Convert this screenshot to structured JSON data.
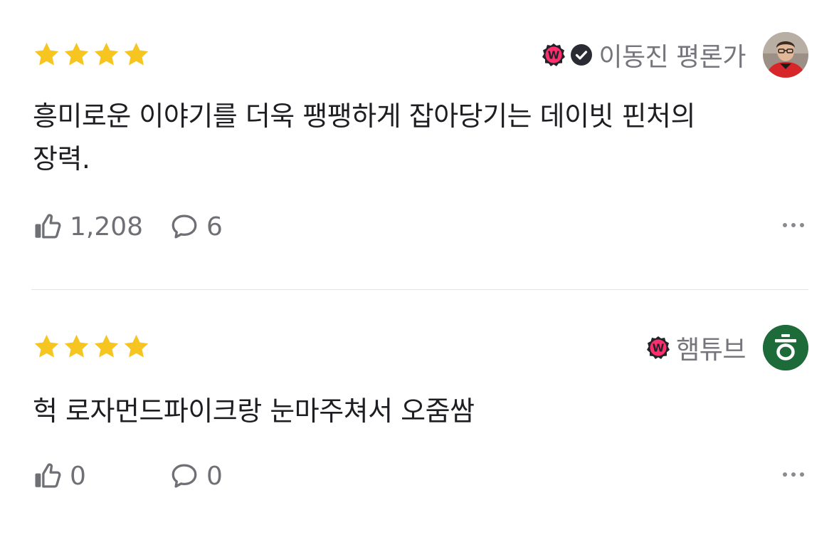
{
  "reviews": [
    {
      "rating": 4,
      "author": {
        "name": "이동진 평론가",
        "badge_w": "W",
        "verified_icon": "check-circle-icon",
        "avatar": "avatar-photo"
      },
      "text_line1": "흥미로운 이야기를 더욱 팽팽하게 잡아당기는 데이빗 핀처의",
      "text_line2": "장력.",
      "likes": "1,208",
      "comments": "6"
    },
    {
      "rating": 4,
      "author": {
        "name": "햄튜브",
        "badge_w": "W",
        "avatar_letter": "ㅎ",
        "avatar_color": "#1e6b3a"
      },
      "text_line1": "헉 로자먼드파이크랑 눈마주쳐서 오줌쌈",
      "likes": "0",
      "comments": "0"
    }
  ],
  "colors": {
    "star": "#f7c520",
    "badge": "#ff2f6e",
    "icon_gray": "#6f6f76",
    "divider": "#e4e4e7"
  }
}
